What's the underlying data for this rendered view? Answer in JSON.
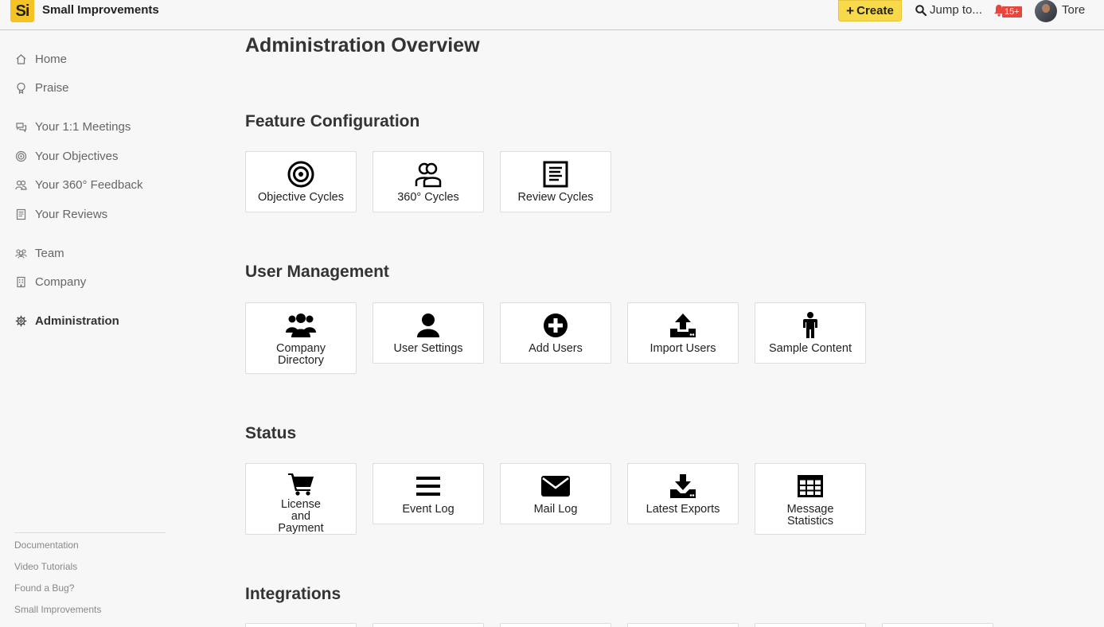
{
  "header": {
    "logo_text": "Si",
    "brand": "Small Improvements",
    "create_label": "Create",
    "jump_label": "Jump to...",
    "notification_count": "15+",
    "user_name": "Tore"
  },
  "sidebar": {
    "items": [
      {
        "label": "Home",
        "icon": "home-icon"
      },
      {
        "label": "Praise",
        "icon": "praise-icon"
      },
      {
        "label": "Your 1:1 Meetings",
        "icon": "chat-icon"
      },
      {
        "label": "Your Objectives",
        "icon": "target-icon"
      },
      {
        "label": "Your 360° Feedback",
        "icon": "people-icon"
      },
      {
        "label": "Your Reviews",
        "icon": "document-icon"
      },
      {
        "label": "Team",
        "icon": "team-icon"
      },
      {
        "label": "Company",
        "icon": "building-icon"
      },
      {
        "label": "Administration",
        "icon": "gear-icon"
      }
    ],
    "footer_links": [
      "Documentation",
      "Video Tutorials",
      "Found a Bug?",
      "Small Improvements"
    ]
  },
  "main": {
    "title": "Administration Overview",
    "sections": [
      {
        "title": "Feature Configuration",
        "cards": [
          {
            "label": "Objective Cycles",
            "icon": "target-icon"
          },
          {
            "label": "360° Cycles",
            "icon": "people-outline-icon"
          },
          {
            "label": "Review Cycles",
            "icon": "document-icon"
          }
        ]
      },
      {
        "title": "User Management",
        "cards": [
          {
            "label": "Company Directory",
            "icon": "users-group-icon"
          },
          {
            "label": "User Settings",
            "icon": "user-icon"
          },
          {
            "label": "Add Users",
            "icon": "plus-circle-icon"
          },
          {
            "label": "Import Users",
            "icon": "upload-icon"
          },
          {
            "label": "Sample Content",
            "icon": "person-icon"
          }
        ]
      },
      {
        "title": "Status",
        "cards": [
          {
            "label": "License and Payment",
            "icon": "cart-icon"
          },
          {
            "label": "Event Log",
            "icon": "list-icon"
          },
          {
            "label": "Mail Log",
            "icon": "envelope-icon"
          },
          {
            "label": "Latest Exports",
            "icon": "download-icon"
          },
          {
            "label": "Message Statistics",
            "icon": "table-icon"
          }
        ]
      },
      {
        "title": "Integrations",
        "cards": []
      }
    ]
  },
  "colors": {
    "accent": "#f5c324",
    "create_button": "#f8d94a",
    "notification_badge": "#e8453c",
    "background": "#f7f7f7"
  }
}
